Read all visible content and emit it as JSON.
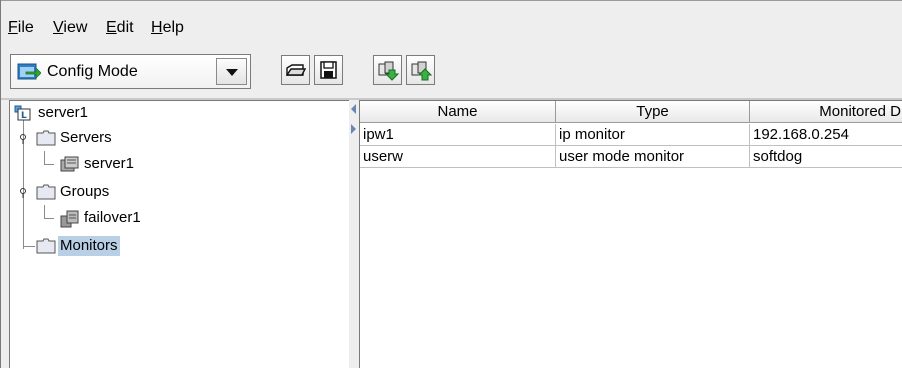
{
  "menubar": {
    "items": [
      {
        "label": "File",
        "mnemonic": "F",
        "rest": "ile"
      },
      {
        "label": "View",
        "mnemonic": "V",
        "rest": "iew"
      },
      {
        "label": "Edit",
        "mnemonic": "E",
        "rest": "dit"
      },
      {
        "label": "Help",
        "mnemonic": "H",
        "rest": "elp"
      }
    ]
  },
  "toolbar": {
    "mode_select": {
      "value": "Config Mode",
      "icon": "config-mode-icon"
    },
    "buttons": [
      {
        "name": "open-button",
        "icon": "folder-open-icon"
      },
      {
        "name": "save-button",
        "icon": "floppy-save-icon"
      },
      {
        "name": "download-button",
        "icon": "get-config-icon"
      },
      {
        "name": "upload-button",
        "icon": "apply-config-icon"
      }
    ]
  },
  "tree": {
    "root": {
      "label": "server1",
      "icon": "cluster-icon"
    },
    "servers": {
      "label": "Servers",
      "icon": "folder-icon"
    },
    "server1": {
      "label": "server1",
      "icon": "server-icon"
    },
    "groups": {
      "label": "Groups",
      "icon": "folder-icon"
    },
    "failover1": {
      "label": "failover1",
      "icon": "group-icon"
    },
    "monitors": {
      "label": "Monitors",
      "icon": "folder-icon",
      "selected": true
    }
  },
  "table": {
    "columns": [
      "Name",
      "Type",
      "Monitored D"
    ],
    "rows": [
      [
        "ipw1",
        "ip monitor",
        "192.168.0.254"
      ],
      [
        "userw",
        "user mode monitor",
        "softdog"
      ]
    ]
  },
  "colors": {
    "window_bg": "#eeeeee",
    "selection": "#b8cfe5",
    "folder": "#e8e8f0"
  }
}
